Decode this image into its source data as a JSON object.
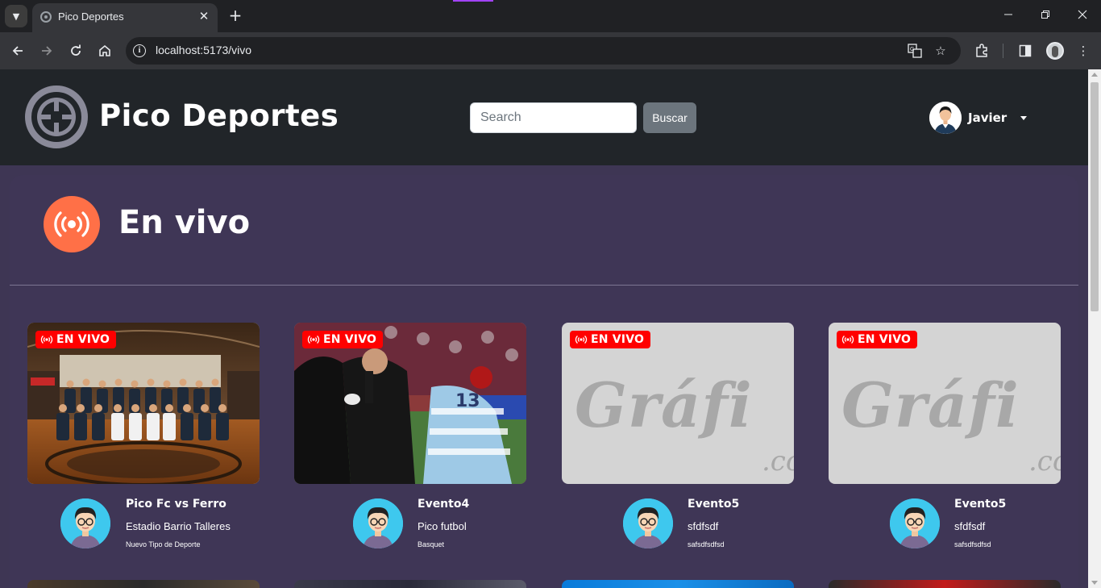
{
  "browser": {
    "tab_title": "Pico Deportes",
    "url": "localhost:5173/vivo",
    "new_tab_symbol": "+",
    "close_symbol": "✕"
  },
  "header": {
    "site_title": "Pico Deportes",
    "search_placeholder": "Search",
    "search_button": "Buscar",
    "user_name": "Javier"
  },
  "section": {
    "title": "En vivo",
    "icon": "broadcast-icon"
  },
  "live_badge_label": "EN VIVO",
  "events": [
    {
      "title": "Pico Fc vs Ferro",
      "venue": "Estadio Barrio Talleres",
      "sport": "Nuevo Tipo de Deporte",
      "image": "basketball-team-photo"
    },
    {
      "title": "Evento4",
      "venue": "Pico futbol",
      "sport": "Basquet",
      "image": "rugby-match-photo"
    },
    {
      "title": "Evento5",
      "venue": "sfdfsdf",
      "sport": "safsdfsdfsd",
      "image": "placeholder-grafica"
    },
    {
      "title": "Evento5",
      "venue": "sfdfsdf",
      "sport": "safsdfsdfsd",
      "image": "placeholder-grafica"
    }
  ],
  "placeholder": {
    "text": "Gráfi",
    "suffix": ".co"
  },
  "colors": {
    "page_bg": "#3e3654",
    "header_bg": "#212529",
    "live_red": "#ff0000",
    "section_icon_bg": "#ff7047",
    "avatar_bg": "#3ec8ee"
  }
}
